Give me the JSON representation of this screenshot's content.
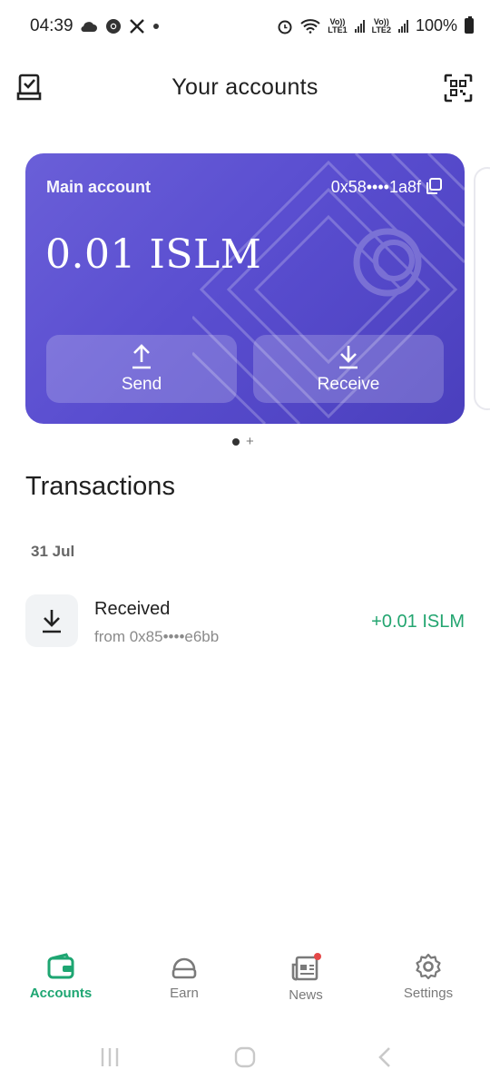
{
  "status_bar": {
    "time": "04:39",
    "battery": "100%",
    "sim1": "LTE1",
    "sim2": "LTE2",
    "volte": "Vo))"
  },
  "header": {
    "title": "Your accounts"
  },
  "account_card": {
    "name": "Main account",
    "address": "0x58••••1a8f",
    "balance": "0.01 ISLM",
    "send_label": "Send",
    "receive_label": "Receive",
    "gradient_color": "#5a4ed0"
  },
  "transactions": {
    "title": "Transactions",
    "groups": [
      {
        "date": "31 Jul",
        "items": [
          {
            "label": "Received",
            "from": "from 0x85••••e6bb",
            "amount": "+0.01 ISLM",
            "amount_color": "#23a570"
          }
        ]
      }
    ]
  },
  "bottom_nav": {
    "items": [
      {
        "label": "Accounts",
        "icon": "wallet-icon",
        "active": true
      },
      {
        "label": "Earn",
        "icon": "earn-icon",
        "active": false
      },
      {
        "label": "News",
        "icon": "news-icon",
        "active": false
      },
      {
        "label": "Settings",
        "icon": "gear-icon",
        "active": false
      }
    ],
    "accent": "#1ea672"
  }
}
